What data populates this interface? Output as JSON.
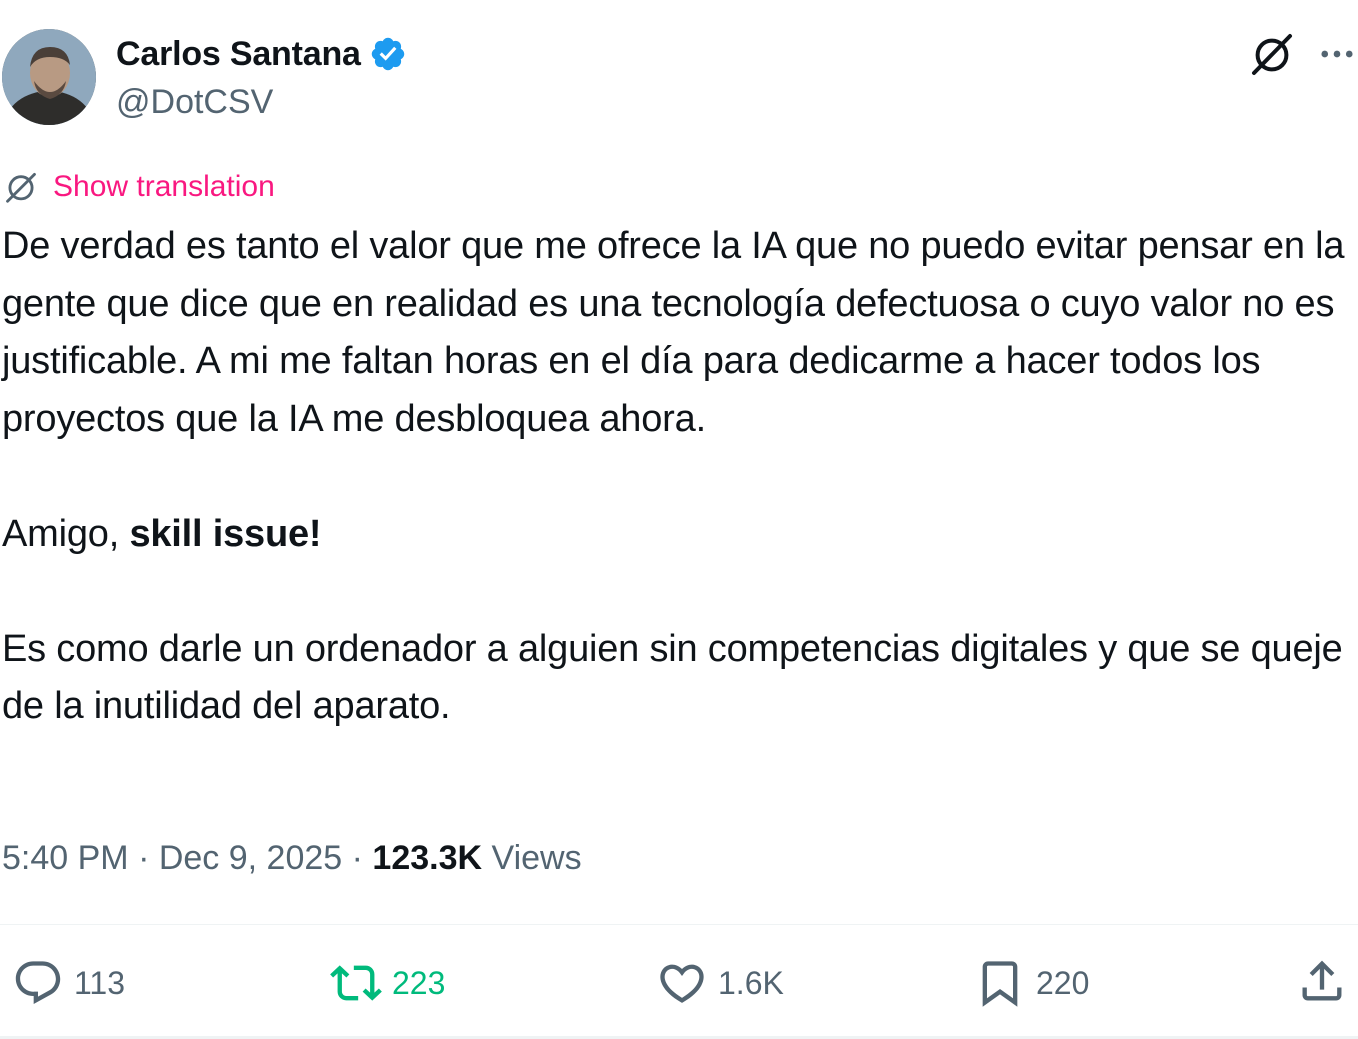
{
  "author": {
    "name": "Carlos Santana",
    "handle": "@DotCSV",
    "verified_color": "#1d9bf0"
  },
  "header_icons": [
    "grok-icon",
    "more-icon"
  ],
  "translate": {
    "label": "Show translation",
    "color": "#f91880"
  },
  "tweet": {
    "paragraph1": "De verdad es tanto el valor que me ofrece la IA que no puedo evitar pensar en la gente que dice que en realidad es una tecnología defectuosa o cuyo valor no es justificable. A mi me faltan horas en el día para dedicarme a hacer todos los proyectos que la IA me desbloquea ahora.",
    "paragraph2_prefix": "Amigo, ",
    "paragraph2_bold": "skill issue!",
    "paragraph3": "Es como darle un ordenador a alguien sin competencias digitales y que se queje de la inutilidad del aparato."
  },
  "meta": {
    "time": "5:40 PM",
    "separator": " · ",
    "date": "Dec 9, 2025",
    "views_count": "123.3K",
    "views_label": " Views"
  },
  "actions": {
    "replies": "113",
    "reposts": "223",
    "likes": "1.6K",
    "bookmarks": "220"
  },
  "colors": {
    "text": "#0f1419",
    "secondary": "#536471",
    "repost_green": "#00ba7c"
  }
}
